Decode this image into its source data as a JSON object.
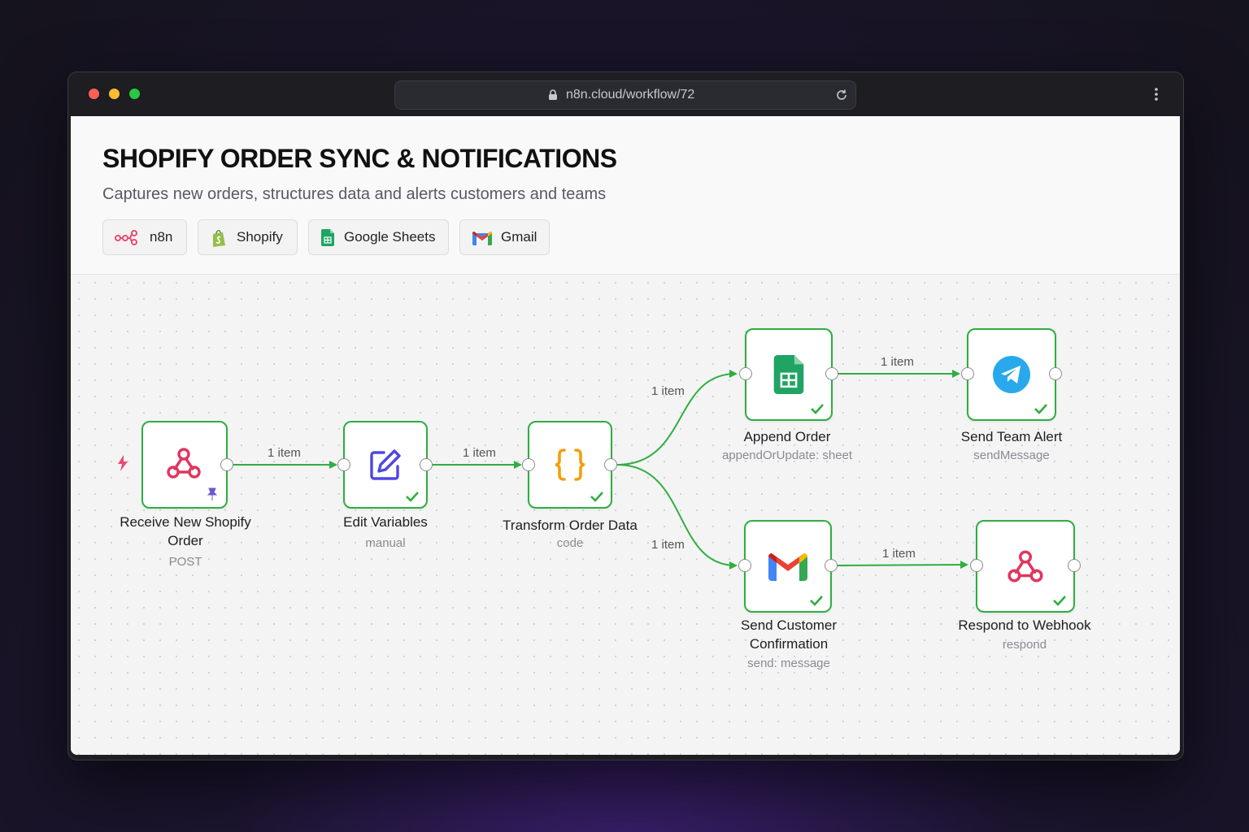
{
  "browser": {
    "url": "n8n.cloud/workflow/72",
    "traffic_lights": [
      "#ff5f57",
      "#febc2e",
      "#28c840"
    ]
  },
  "header": {
    "title": "SHOPIFY ORDER SYNC & NOTIFICATIONS",
    "subtitle": "Captures new orders, structures data and alerts customers and teams",
    "chips": [
      {
        "label": "n8n",
        "icon": "n8n-logo-icon"
      },
      {
        "label": "Shopify",
        "icon": "shopify-icon"
      },
      {
        "label": "Google Sheets",
        "icon": "google-sheets-icon"
      },
      {
        "label": "Gmail",
        "icon": "gmail-icon"
      }
    ]
  },
  "workflow": {
    "accent": "#2fae3f",
    "nodes": [
      {
        "id": "webhook",
        "label": "Receive New Shopify Order",
        "sub": "POST",
        "icon": "webhook-icon"
      },
      {
        "id": "edit",
        "label": "Edit Variables",
        "sub": "manual",
        "icon": "edit-pencil-icon"
      },
      {
        "id": "code",
        "label": "Transform Order Data",
        "sub": "code",
        "icon": "code-braces-icon"
      },
      {
        "id": "sheets",
        "label": "Append Order",
        "sub": "appendOrUpdate: sheet",
        "icon": "google-sheets-icon"
      },
      {
        "id": "telegram",
        "label": "Send Team Alert",
        "sub": "sendMessage",
        "icon": "telegram-icon"
      },
      {
        "id": "gmail",
        "label": "Send Customer Confirmation",
        "sub": "send: message",
        "icon": "gmail-icon"
      },
      {
        "id": "respond",
        "label": "Respond to Webhook",
        "sub": "respond",
        "icon": "webhook-icon"
      }
    ],
    "edges": [
      {
        "from": "webhook",
        "to": "edit",
        "label": "1 item"
      },
      {
        "from": "edit",
        "to": "code",
        "label": "1 item"
      },
      {
        "from": "code",
        "to": "sheets",
        "label": "1 item"
      },
      {
        "from": "code",
        "to": "gmail",
        "label": "1 item"
      },
      {
        "from": "sheets",
        "to": "telegram",
        "label": "1 item"
      },
      {
        "from": "gmail",
        "to": "respond",
        "label": "1 item"
      }
    ]
  }
}
